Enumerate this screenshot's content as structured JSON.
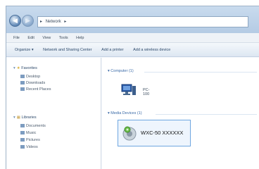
{
  "address": {
    "crumbs": [
      "▸",
      "Network",
      "▸"
    ]
  },
  "menubar": [
    "File",
    "Edit",
    "View",
    "Tools",
    "Help"
  ],
  "toolbar": [
    "Organize ▾",
    "Network and Sharing Center",
    "Add a printer",
    "Add a wireless device"
  ],
  "navpane": {
    "favorites": {
      "label": "Favorites",
      "items": [
        "Desktop",
        "Downloads",
        "Recent Places"
      ]
    },
    "libraries": {
      "label": "Libraries",
      "items": [
        "Documents",
        "Music",
        "Pictures",
        "Videos"
      ]
    }
  },
  "content": {
    "computer_group": "Computer (1)",
    "computer_name": "PC-100",
    "media_group": "Media Devices (1)",
    "media_device": "WXC-50 XXXXXX"
  }
}
